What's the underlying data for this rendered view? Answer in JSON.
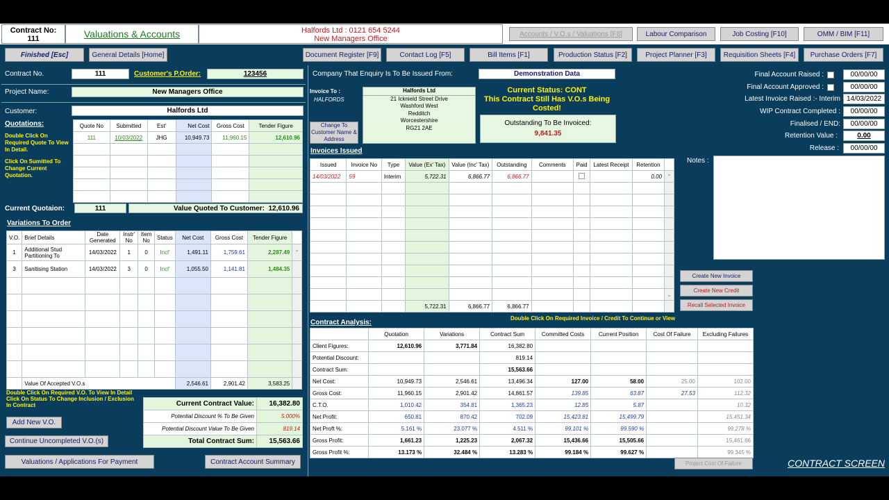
{
  "header": {
    "contract_no_label": "Contract No:",
    "contract_no": "111",
    "title": "Valuations & Accounts",
    "company_line": "Halfords Ltd : 0121 654 5244",
    "project_line": "New Managers Office",
    "top_buttons": [
      "Accounts / V.O.s / Valuations [F8]",
      "Labour Comparison",
      "Job Costing [F10]",
      "OMM / BIM [F11]"
    ]
  },
  "nav": {
    "finished": "Finished [Esc]",
    "general": "General Details [Home]",
    "buttons": [
      "Document Register [F9]",
      "Contact Log [F5]",
      "Bill Items [F1]",
      "Production Status [F2]",
      "Project Planner [F3]",
      "Requisition Sheets [F4]",
      "Purchase Orders [F7]"
    ]
  },
  "left": {
    "contract_no_label": "Contract No.",
    "contract_no": "111",
    "po_label": "Customer's P.Order:",
    "po": "123456",
    "project_label": "Project Name:",
    "project": "New Managers Office",
    "customer_label": "Customer:",
    "customer": "Halfords Ltd",
    "quotations_label": "Quotations:",
    "quote_help1": "Double Click On Required Quote To View In Detail.",
    "quote_help2": "Click On Sumitted To Change Current Quotation.",
    "quote_headers": [
      "Quote No",
      "Submitted",
      "Est'",
      "Net Cost",
      "Gross Cost",
      "Tender Figure"
    ],
    "quote_rows": [
      [
        "111",
        "10/03/2022",
        "JHG",
        "10,949.73",
        "11,960.15",
        "12,610.96"
      ]
    ],
    "current_quote_label": "Current Quotaion:",
    "current_quote": "111",
    "value_quoted_label": "Value Quoted To Customer:",
    "value_quoted": "12,610.96",
    "variations_label": "Variations To Order",
    "var_headers": [
      "V.O.",
      "Brief Details",
      "Date Generated",
      "Instr' No",
      "Item No",
      "Status",
      "Net Cost",
      "Gross Cost",
      "Tender Figure"
    ],
    "var_rows": [
      [
        "1",
        "Additional Stud Partitioning To",
        "14/03/2022",
        "1",
        "0",
        "Incl'",
        "1,491.11",
        "1,759.61",
        "2,287.49"
      ],
      [
        "3",
        "Sanitising Station",
        "14/03/2022",
        "3",
        "0",
        "Incl'",
        "1,055.50",
        "1,141.81",
        "1,484.35"
      ]
    ],
    "accepted_label": "Value Of Accepted V.O.s",
    "accepted_net": "2,546.61",
    "accepted_gross": "2,901.42",
    "accepted_tender": "3,583.25",
    "vo_help1": "Double Click On Required V.O. To View In Detail",
    "vo_help2": "Click On Status To Change Inclusion / Exclusion In Contract",
    "current_contract_label": "Current Contract Value:",
    "current_contract": "16,382.80",
    "discount_pct_label": "Potential Discount % To Be Given",
    "discount_pct": "5.000%",
    "discount_val_label": "Potential Discount Value To Be Given",
    "discount_val": "819.14",
    "total_label": "Total Contract Sum:",
    "total": "15,563.66",
    "add_vo": "Add New V.O.",
    "continue_vo": "Continue Uncompleted V.O.(s)",
    "valuations_btn": "Valuations / Applications For Payment",
    "summary_btn": "Contract Account Summary"
  },
  "middle": {
    "enquiry_label": "Company That Enquiry Is To Be Issued From:",
    "enquiry_value": "Demonstration Data",
    "invoice_to_label": "Invoice To :",
    "invoice_to_code": "HALFORDS",
    "address": [
      "Halfords Ltd",
      "21 Icknield Street Drive",
      "Washford West",
      "Redditch",
      "Worcestershire",
      "RG21 2AE"
    ],
    "change_btn": "Change To Customer Name & Address",
    "status_line1": "Current Status: CONT",
    "status_line2": "This Contract Still Has V.O.s Being Costed!",
    "outstanding_label": "Outstanding To Be Invoiced:",
    "outstanding": "9,841.35",
    "invoices_label": "Invoices Issued",
    "inv_headers": [
      "Issued",
      "Invoice No",
      "Type",
      "Value (Ex' Tax)",
      "Value (Inc' Tax)",
      "Outstanding",
      "Comments",
      "Paid",
      "Latest Receipt",
      "Retention"
    ],
    "inv_rows": [
      [
        "14/03/2022",
        "59",
        "Interim",
        "5,722.31",
        "6,866.77",
        "6,866.77",
        "",
        "",
        "",
        "0.00"
      ]
    ],
    "inv_totals": [
      "5,722.31",
      "6,866.77",
      "6,866.77"
    ],
    "inv_help": "Double Click On Required Invoice / Credit To Continue or View",
    "create_invoice": "Create New Invoice",
    "create_credit": "Create New Credit",
    "recall_invoice": "Recall Selected Invoice",
    "analysis_label": "Contract Analysis:",
    "an_headers": [
      "",
      "Quotation",
      "Variations",
      "Contract Sum",
      "Committed Costs",
      "Current Position",
      "Cost Of Failure",
      "Excluding Failures"
    ],
    "an_rows": [
      [
        "Client Figures:",
        "12,610.96",
        "3,771.84",
        "16,382.80",
        "",
        "",
        "",
        ""
      ],
      [
        "Potential Discount:",
        "",
        "",
        "819.14",
        "",
        "",
        "",
        ""
      ],
      [
        "Contract Sum:",
        "",
        "",
        "15,563.66",
        "",
        "",
        "",
        ""
      ],
      [
        "Net Cost:",
        "10,949.73",
        "2,546.61",
        "13,496.34",
        "127.00",
        "58.00",
        "25.00",
        "102.00"
      ],
      [
        "Gross Cost:",
        "11,960.15",
        "2,901.42",
        "14,861.57",
        "139.85",
        "63.87",
        "27.53",
        "112.32"
      ],
      [
        "C.T.O.",
        "1,010.42",
        "354.81",
        "1,365.23",
        "12.85",
        "5.87",
        "",
        "10.32"
      ],
      [
        "Net Profit:",
        "650.81",
        "870.42",
        "702.09",
        "15,423.81",
        "15,499.79",
        "",
        "15,451.34"
      ],
      [
        "Net Proft %:",
        "5.161 %",
        "23.077 %",
        "4.511 %",
        "99.101 %",
        "99.590 %",
        "",
        "99.278 %"
      ],
      [
        "Gross Profit:",
        "1,661.23",
        "1,225.23",
        "2,067.32",
        "15,436.66",
        "15,505.66",
        "",
        "15,461.66"
      ],
      [
        "Gross Profit %:",
        "13.173 %",
        "32.484 %",
        "13.283 %",
        "99.184 %",
        "99.627 %",
        "",
        "99.345 %"
      ]
    ]
  },
  "right": {
    "final_raised_label": "Final Account Raised :",
    "final_raised": "00/00/00",
    "final_approved_label": "Final Account Approved :",
    "final_approved": "00/00/00",
    "latest_invoice_label": "Latest Invoice Raised :-  Interim",
    "latest_invoice": "14/03/2022",
    "wip_label": "WIP Contract Completed :",
    "wip": "00/00/00",
    "finalised_label": "Finalised / END:",
    "finalised": "00/00/00",
    "retention_label": "Retention Value :",
    "retention": "0.00",
    "release_label": "Release :",
    "release": "00/00/00",
    "notes_label": "Notes :",
    "project_cost_btn": "Project Cost Of Failure",
    "screen_title": "CONTRACT SCREEN"
  }
}
